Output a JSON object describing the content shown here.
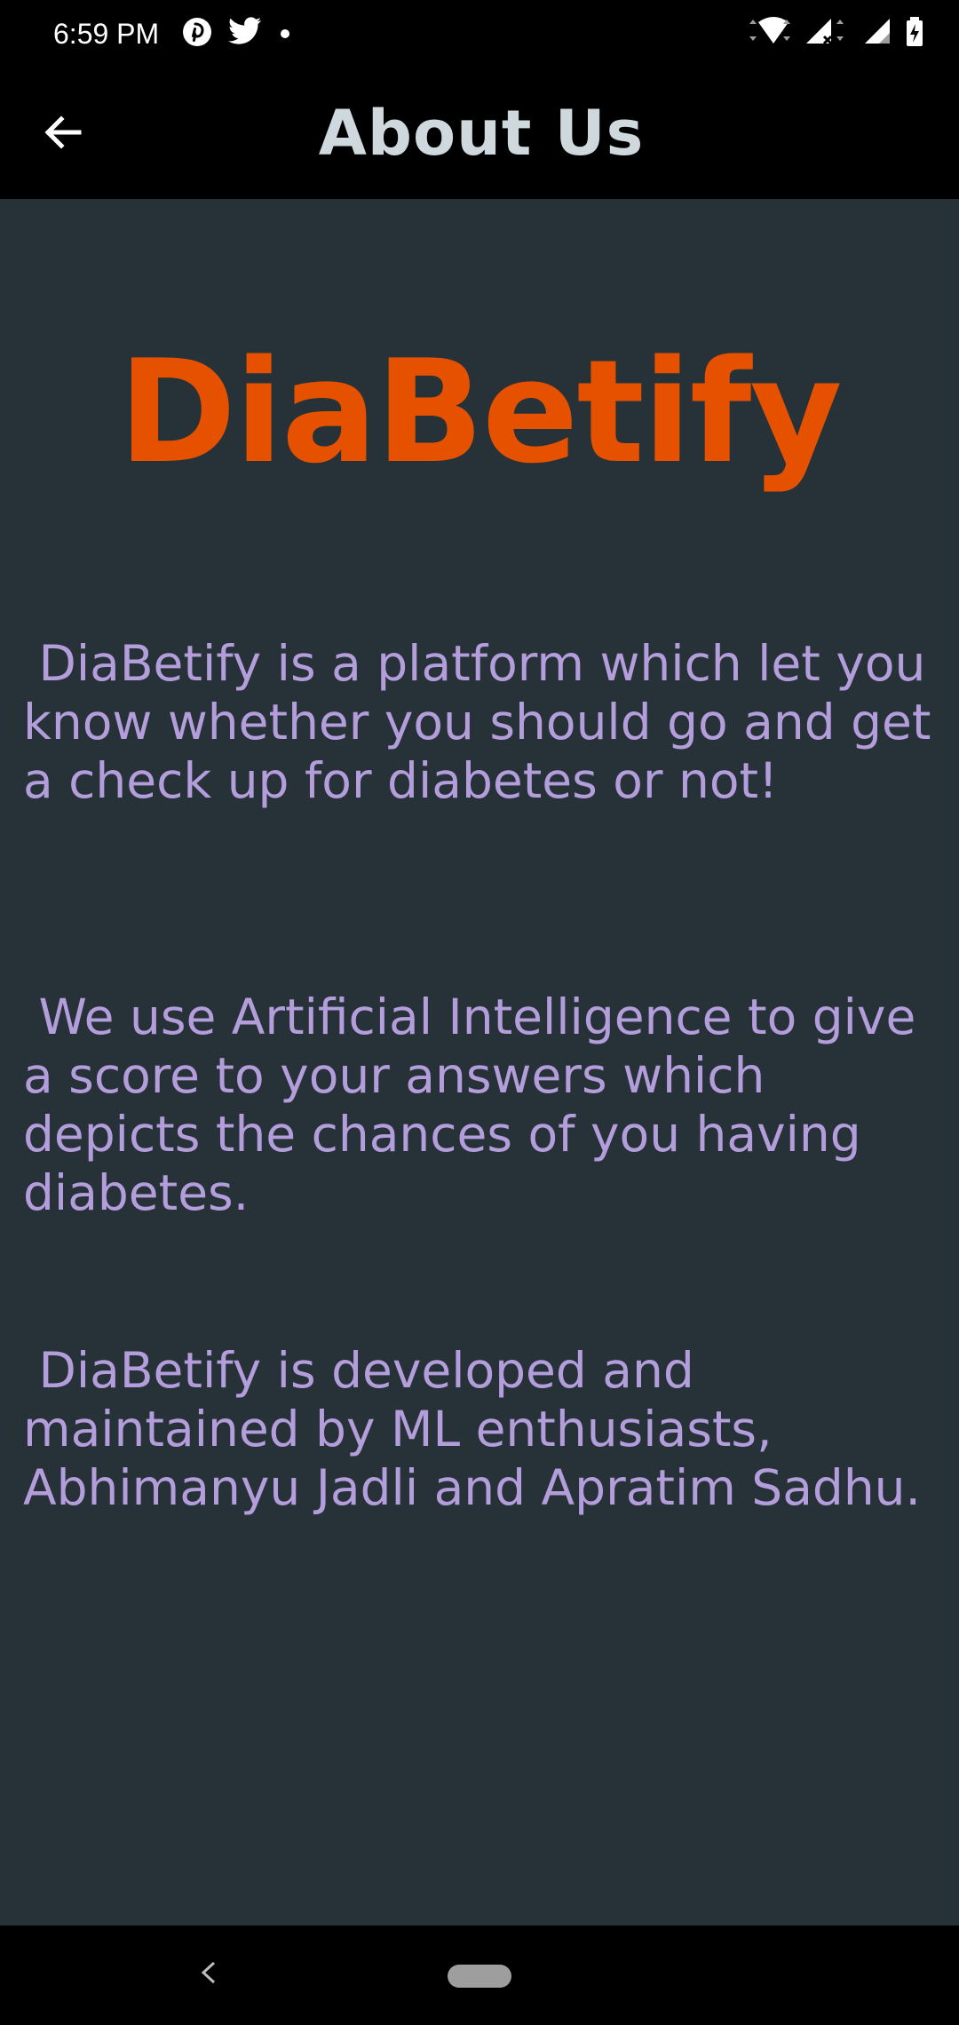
{
  "status_bar": {
    "time": "6:59 PM",
    "icons_left": [
      "pinterest-icon",
      "twitter-icon",
      "notification-dot-icon"
    ],
    "icons_right": [
      "wifi-icon",
      "signal-icon",
      "signal-icon",
      "battery-icon"
    ]
  },
  "app_bar": {
    "title": "About Us",
    "back_icon": "arrow-left-icon"
  },
  "brand": {
    "logo_text": "DiaBetify",
    "color": "#e65100"
  },
  "paragraphs": [
    " DiaBetify is a platform which let you know whether you should go and get a check up for diabetes or not!",
    " We use Artificial Intelligence to give a score to your answers which depicts the chances of you having diabetes.",
    " DiaBetify is developed and maintained by ML enthusiasts, Abhimanyu Jadli and Apratim Sadhu."
  ],
  "colors": {
    "background": "#263238",
    "text": "#b39ddb",
    "title": "#cfd8dc",
    "bars": "#000000"
  },
  "nav_bar": {
    "back_icon": "nav-back-icon",
    "home_icon": "home-pill-icon"
  }
}
